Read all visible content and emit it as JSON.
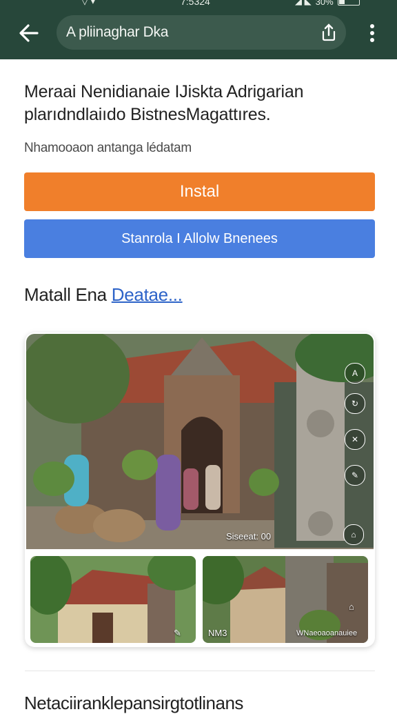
{
  "status_bar": {
    "time": "7:5324",
    "right_text": "30%"
  },
  "toolbar": {
    "url_text": "A pliinaghar Dka",
    "share_icon": "share-icon",
    "menu_icon": "more-vert-icon",
    "back_icon": "arrow-back-icon"
  },
  "article": {
    "headline": "Meraai Nenidianaie IJiskta Adrigarian plarıdndlaiıdo BistnesMagattıres.",
    "subtitle": "Nhamooaon antanga lédatam",
    "install_label": "Instal",
    "secondary_label": "Stanrola I Allolw Bnenees",
    "section_title": "Matall Ena",
    "section_link": "Deatae...",
    "bottom_text": "Netaciiranklepansirgtotlinans"
  },
  "gallery": {
    "main_caption": "Siseeat: 00",
    "thumb2_caption": "WNaeoaoanauiee",
    "thumb1_caption": "NM3",
    "icons": [
      "rotate-icon",
      "hide-icon",
      "info-icon",
      "edit-icon",
      "tag-icon"
    ],
    "top_badge": "A"
  },
  "colors": {
    "toolbar": "#27473a",
    "install": "#f07f2b",
    "secondary": "#4a7fe0",
    "link": "#2d63c8"
  }
}
